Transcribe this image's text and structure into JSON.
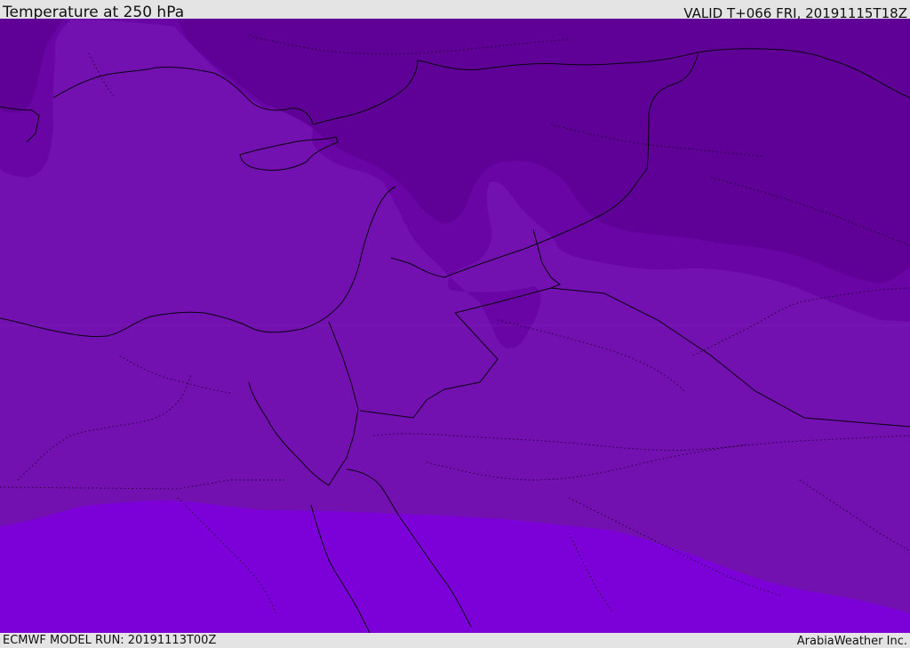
{
  "header": {
    "title": "Temperature at 250 hPa",
    "valid": "VALID T+066 FRI, 20191115T18Z"
  },
  "footer": {
    "model_run": "ECMWF MODEL RUN: 20191113T00Z",
    "credit": "ArabiaWeather Inc."
  },
  "map": {
    "field": "temperature",
    "level": "250 hPa",
    "colors": {
      "band_coldest": "#5f0196",
      "band_cold": "#6a05a5",
      "band_mid": "#7210b0",
      "band_warm": "#7c01d9",
      "boundary_line": "#0a0010"
    }
  }
}
